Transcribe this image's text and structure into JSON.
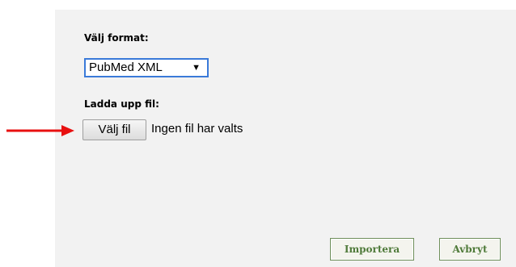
{
  "format": {
    "label": "Välj format:",
    "selected": "PubMed XML",
    "arrow": "▼"
  },
  "upload": {
    "label": "Ladda upp fil:",
    "button_label": "Välj fil",
    "status_text": "Ingen fil har valts"
  },
  "actions": {
    "import_label": "Importera",
    "cancel_label": "Avbryt"
  },
  "annotation": {
    "arrow_color": "#e81010",
    "arrow_icon": "right-arrow-icon"
  }
}
